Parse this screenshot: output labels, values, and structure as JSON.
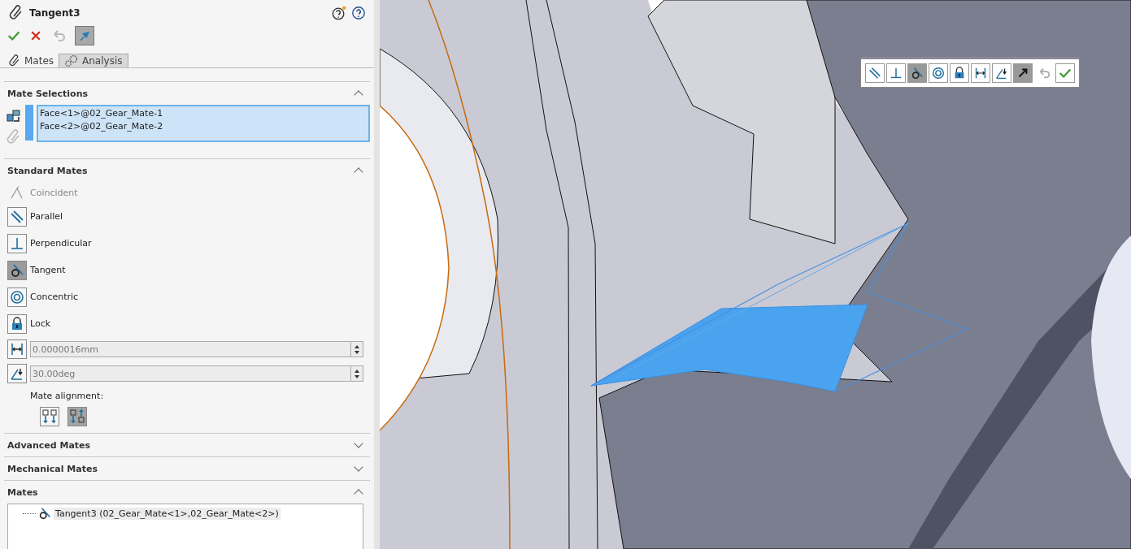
{
  "panel": {
    "title": "Tangent3",
    "tabs": [
      {
        "label": "Mates",
        "selected": true
      },
      {
        "label": "Analysis",
        "selected": false
      }
    ],
    "mate_selections": {
      "title": "Mate Selections",
      "expanded": true,
      "items": [
        "Face<1>@02_Gear_Mate-1",
        "Face<2>@02_Gear_Mate-2"
      ]
    },
    "standard_mates": {
      "title": "Standard Mates",
      "expanded": true,
      "options": [
        {
          "kind": "coincident",
          "label": "Coincident",
          "selected": false,
          "disabled": true
        },
        {
          "kind": "parallel",
          "label": "Parallel",
          "selected": false,
          "disabled": false
        },
        {
          "kind": "perpendicular",
          "label": "Perpendicular",
          "selected": false,
          "disabled": false
        },
        {
          "kind": "tangent",
          "label": "Tangent",
          "selected": true,
          "disabled": false
        },
        {
          "kind": "concentric",
          "label": "Concentric",
          "selected": false,
          "disabled": false
        },
        {
          "kind": "lock",
          "label": "Lock",
          "selected": false,
          "disabled": false
        }
      ],
      "fields": [
        {
          "kind": "distance",
          "value": "0.0000016mm"
        },
        {
          "kind": "angle",
          "value": "30.00deg"
        }
      ],
      "alignment_label": "Mate alignment:",
      "alignment": [
        {
          "selected": false
        },
        {
          "selected": true
        }
      ]
    },
    "advanced_mates": {
      "title": "Advanced Mates",
      "expanded": false
    },
    "mechanical_mates": {
      "title": "Mechanical Mates",
      "expanded": false
    },
    "mates": {
      "title": "Mates",
      "expanded": true,
      "items": [
        {
          "kind": "tangent",
          "label": "Tangent3 (02_Gear_Mate<1>,02_Gear_Mate<2>)"
        }
      ]
    }
  },
  "popup_toolbar": {
    "buttons": [
      {
        "kind": "parallel",
        "selected": false
      },
      {
        "kind": "perpendicular",
        "selected": false
      },
      {
        "kind": "tangent",
        "selected": true
      },
      {
        "kind": "concentric",
        "selected": false
      },
      {
        "kind": "lock",
        "selected": false
      },
      {
        "kind": "distance",
        "selected": false
      },
      {
        "kind": "angle",
        "selected": false
      },
      {
        "kind": "flip",
        "selected": true
      },
      {
        "kind": "undo",
        "selected": false
      },
      {
        "kind": "ok",
        "selected": false
      }
    ]
  }
}
